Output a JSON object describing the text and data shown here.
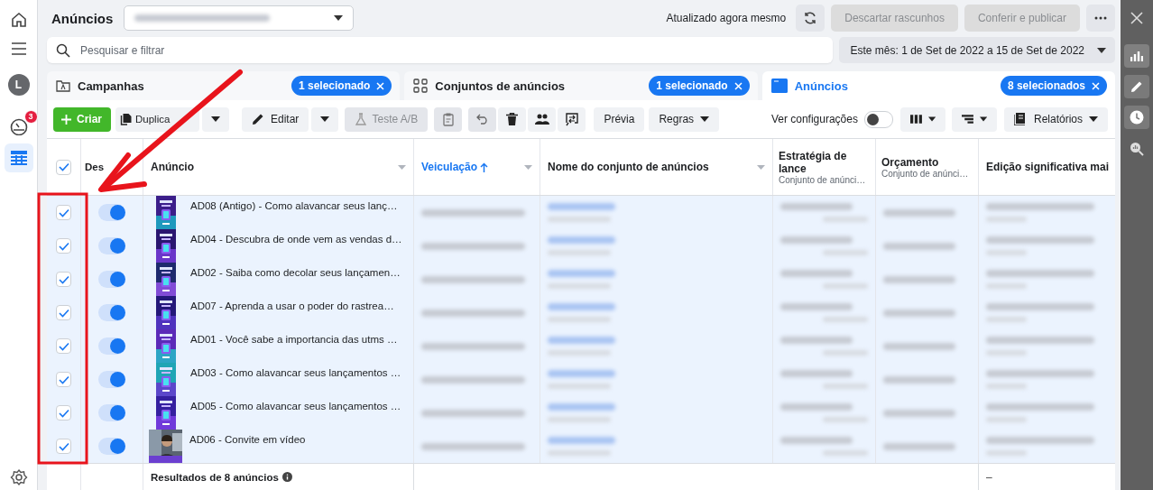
{
  "left_rail": {
    "avatar": "L",
    "notification_badge": "3"
  },
  "header": {
    "title": "Anúncios",
    "status": "Atualizado agora mesmo",
    "buttons": [
      {
        "label": "Descartar rascunhos",
        "disabled": true
      },
      {
        "label": "Conferir e publicar",
        "disabled": true
      }
    ]
  },
  "search": {
    "placeholder": "Pesquisar e filtrar"
  },
  "date_range": {
    "label": "Este mês: 1 de Set de 2022 a 15 de Set de 2022"
  },
  "tabs": [
    {
      "label": "Campanhas",
      "badge": "1 selecionado",
      "selected": false
    },
    {
      "label": "Conjuntos de anúncios",
      "badge": "1 selecionado",
      "selected": false
    },
    {
      "label": "Anúncios",
      "badge": "8 selecionados",
      "selected": true
    }
  ],
  "toolbar": {
    "create": "Criar",
    "duplicate": "Duplica",
    "edit": "Editar",
    "ab_test": {
      "label": "Teste A/B",
      "disabled": true
    },
    "preview": "Prévia",
    "rules": "Regras",
    "view_settings": {
      "label": "Ver configurações",
      "on": false
    },
    "reports": "Relatórios"
  },
  "table": {
    "all_checked": true,
    "columns": [
      {
        "label": "Des"
      },
      {
        "label": "Anúncio",
        "menu": true
      },
      {
        "label": "Veiculação",
        "sorted": true,
        "menu": true
      },
      {
        "label": "Nome do conjunto de anúncios",
        "menu": true
      },
      {
        "label": "Estratégia de lance",
        "subtitle": "Conjunto de anúnci…"
      },
      {
        "label": "Orçamento",
        "subtitle": "Conjunto de anúnci…"
      },
      {
        "label": "Edição significativa mai"
      }
    ],
    "rows": [
      {
        "checked": true,
        "on": true,
        "name": "AD08 (Antigo) - Como alavancar seus lanç…"
      },
      {
        "checked": true,
        "on": true,
        "name": "AD04 - Descubra de onde vem as vendas d…"
      },
      {
        "checked": true,
        "on": true,
        "name": "AD02 - Saiba como decolar seus lançamen…"
      },
      {
        "checked": true,
        "on": true,
        "name": "AD07 - Aprenda a usar o poder do rastrea…"
      },
      {
        "checked": true,
        "on": true,
        "name": "AD01 - Você sabe a importancia das utms …"
      },
      {
        "checked": true,
        "on": true,
        "name": "AD03 - Como alavancar seus lançamentos …"
      },
      {
        "checked": true,
        "on": true,
        "name": "AD05 - Como alavancar seus lançamentos …"
      },
      {
        "checked": true,
        "on": true,
        "name": "AD06 - Convite em vídeo"
      }
    ],
    "footer": {
      "label": "Resultados de 8 anúncios",
      "last_cell": "–"
    }
  }
}
